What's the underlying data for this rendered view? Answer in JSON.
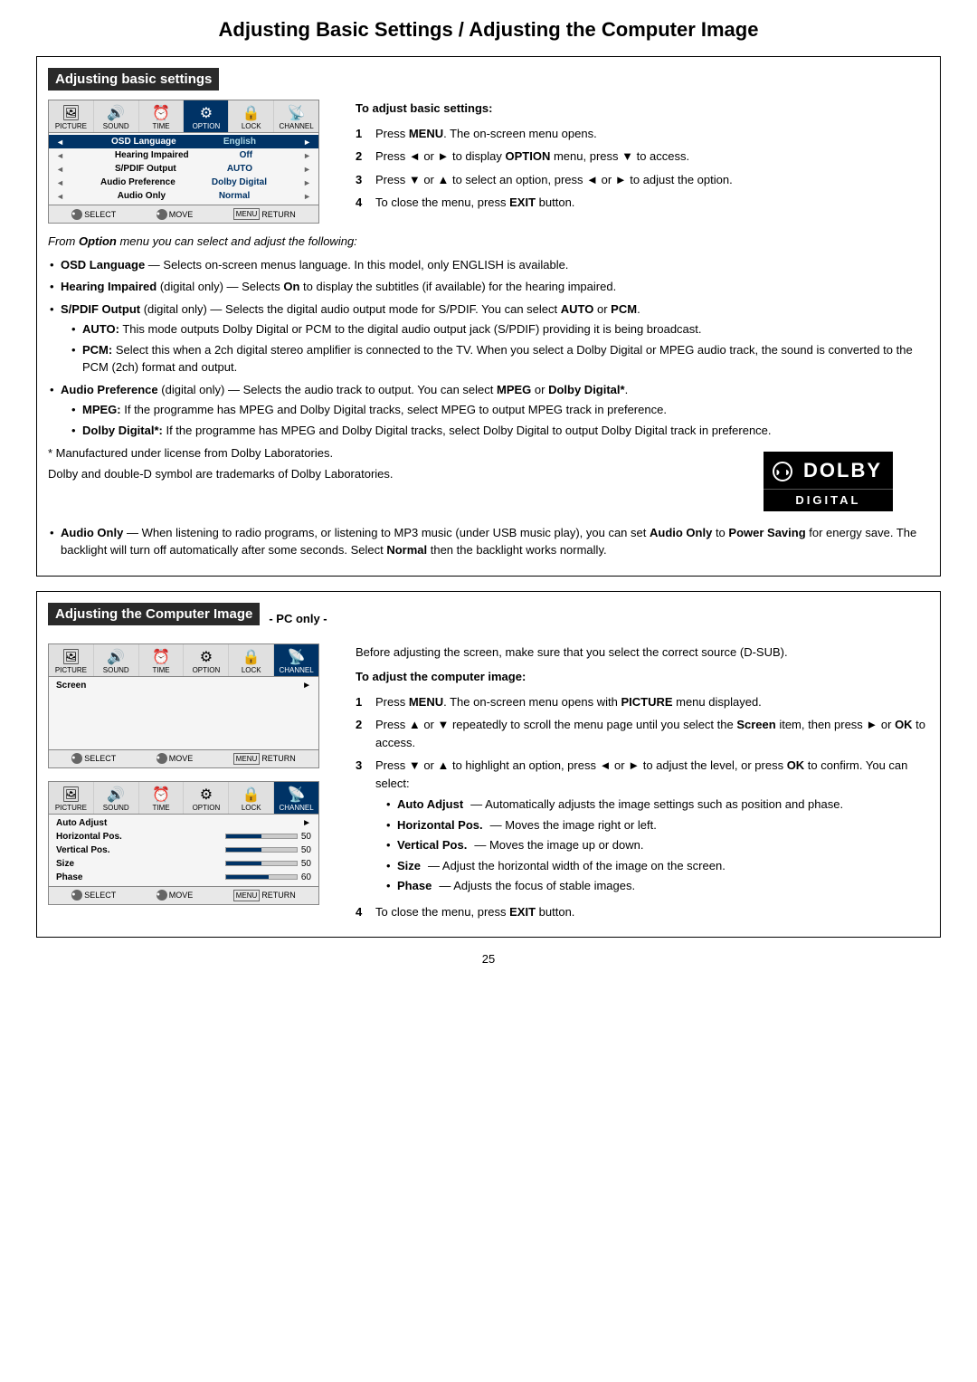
{
  "page": {
    "main_title": "Adjusting Basic Settings / Adjusting the Computer Image",
    "page_number": "25"
  },
  "adjusting_basic": {
    "section_header": "Adjusting basic settings",
    "tv_menu": {
      "icons": [
        {
          "symbol": "🖼",
          "label": "PICTURE"
        },
        {
          "symbol": "🔊",
          "label": "SOUND"
        },
        {
          "symbol": "⏰",
          "label": "TIME"
        },
        {
          "symbol": "⚙",
          "label": "OPTION"
        },
        {
          "symbol": "🔒",
          "label": "LOCK"
        },
        {
          "symbol": "📡",
          "label": "CHANNEL"
        }
      ],
      "rows": [
        {
          "label": "OSD Language",
          "value": "English",
          "highlighted": true
        },
        {
          "label": "Hearing Impaired",
          "value": "Off",
          "highlighted": false
        },
        {
          "label": "S/PDIF Output",
          "value": "AUTO",
          "highlighted": false
        },
        {
          "label": "Audio Preference",
          "value": "Dolby Digital",
          "highlighted": false
        },
        {
          "label": "Audio Only",
          "value": "Normal",
          "highlighted": false
        }
      ],
      "footer": [
        {
          "btn": "●",
          "label": "SELECT"
        },
        {
          "btn": "●",
          "label": "MOVE"
        },
        {
          "btn": "MENU",
          "label": "RETURN"
        }
      ]
    },
    "right_heading": "To adjust basic settings:",
    "steps": [
      {
        "num": "1",
        "text_plain": "Press ",
        "text_bold": "MENU",
        "text_after": ". The on-screen menu opens."
      },
      {
        "num": "2",
        "text_plain": "Press ◄ or ► to display ",
        "text_bold": "OPTION",
        "text_after": " menu, press ▼ to access."
      },
      {
        "num": "3",
        "text_plain": "Press ▼ or ▲ to select an option, press ◄ or ► to adjust the option."
      },
      {
        "num": "4",
        "text_plain": "To close the menu, press ",
        "text_bold": "EXIT",
        "text_after": " button."
      }
    ],
    "from_option_text": "From Option menu you can select and adjust the following:",
    "bullet_items": [
      {
        "bold_label": "OSD Language",
        "dash": " — ",
        "text": "Selects on-screen menus language. In this model, only ENGLISH is available."
      },
      {
        "bold_label": "Hearing Impaired",
        "extra": " (digital only)",
        "dash": " — ",
        "text": "Selects ",
        "bold_mid": "On",
        "text_after": " to display the subtitles (if available) for the hearing impaired."
      },
      {
        "bold_label": "S/PDIF Output",
        "extra": " (digital only)",
        "dash": " — ",
        "text": "Selects the digital audio output mode for S/PDIF. You can select ",
        "bold_mid": "AUTO",
        "text_mid2": " or ",
        "bold_end": "PCM",
        "text_after": ".",
        "sub_items": [
          {
            "bold_label": "AUTO:",
            "text": " This mode outputs Dolby Digital or PCM to the digital audio output jack (S/PDIF) providing it is being broadcast."
          },
          {
            "bold_label": "PCM:",
            "text": " Select this when a 2ch digital stereo amplifier is connected to the TV. When you select a Dolby Digital or MPEG audio track, the sound is converted to the PCM (2ch) format and output."
          }
        ]
      },
      {
        "bold_label": "Audio Preference",
        "extra": " (digital only)",
        "dash": " — ",
        "text": "Selects the audio track to output. You can select ",
        "bold_mid": "MPEG",
        "text_mid2": " or ",
        "bold_end": "Dolby Digital*",
        "text_after": ".",
        "sub_items": [
          {
            "bold_label": "MPEG:",
            "text": " If the programme has MPEG and Dolby Digital tracks, select MPEG to output MPEG track in preference."
          },
          {
            "bold_label": "Dolby Digital*:",
            "text": " If the programme has MPEG and Dolby Digital tracks, select Dolby Digital to output Dolby Digital track in preference."
          }
        ]
      }
    ],
    "trademark_note1": "* Manufactured under license from Dolby Laboratories.",
    "trademark_note2": "Dolby and double-D symbol are trademarks of Dolby Laboratories.",
    "dolby_logo_text": "DOLBY",
    "dolby_digital_text": "DIGITAL",
    "audio_only_bullet": {
      "bold_label": "Audio Only",
      "dash": " — ",
      "text": "When listening to radio programs, or listening to MP3 music (under USB music play), you can set ",
      "bold_mid": "Audio Only",
      "text_mid2": " to ",
      "bold_mid2": "Power Saving",
      "text_after2": " for energy save. The backlight will turn off automatically after some seconds. Select ",
      "bold_end": "Normal",
      "text_end": " then the backlight works normally."
    }
  },
  "adjusting_computer": {
    "section_header": "Adjusting the Computer Image",
    "pc_only_label": "- PC only -",
    "tv_menu1": {
      "icons": [
        {
          "symbol": "🖼",
          "label": "PICTURE"
        },
        {
          "symbol": "🔊",
          "label": "SOUND"
        },
        {
          "symbol": "⏰",
          "label": "TIME"
        },
        {
          "symbol": "⚙",
          "label": "OPTION"
        },
        {
          "symbol": "🔒",
          "label": "LOCK"
        },
        {
          "symbol": "📡",
          "label": "CHANNEL"
        }
      ],
      "rows": [
        {
          "label": "Screen",
          "value": "",
          "arrow": true,
          "highlighted": false
        }
      ]
    },
    "tv_menu2": {
      "icons": [
        {
          "symbol": "🖼",
          "label": "PICTURE"
        },
        {
          "symbol": "🔊",
          "label": "SOUND"
        },
        {
          "symbol": "⏰",
          "label": "TIME"
        },
        {
          "symbol": "⚙",
          "label": "OPTION"
        },
        {
          "symbol": "🔒",
          "label": "LOCK"
        },
        {
          "symbol": "📡",
          "label": "CHANNEL"
        }
      ],
      "rows": [
        {
          "label": "Auto Adjust",
          "value": "",
          "arrow": true,
          "highlighted": false,
          "bar": false
        },
        {
          "label": "Horizontal Pos.",
          "value": "50",
          "highlighted": false,
          "bar": true,
          "bar_pct": 50
        },
        {
          "label": "Vertical Pos.",
          "value": "50",
          "highlighted": false,
          "bar": true,
          "bar_pct": 50
        },
        {
          "label": "Size",
          "value": "50",
          "highlighted": false,
          "bar": true,
          "bar_pct": 50
        },
        {
          "label": "Phase",
          "value": "60",
          "highlighted": false,
          "bar": true,
          "bar_pct": 60
        }
      ]
    },
    "intro_text": "Before adjusting the screen, make sure that you select the correct source (D-SUB).",
    "right_heading": "To adjust the computer image:",
    "steps": [
      {
        "num": "1",
        "text": "Press MENU. The on-screen menu opens with PICTURE menu displayed."
      },
      {
        "num": "2",
        "text": "Press ▲ or ▼ repeatedly to scroll the menu page until you select the Screen item, then press ► or OK to access."
      },
      {
        "num": "3",
        "text": "Press ▼ or ▲ to highlight an option, press ◄ or ► to adjust the level, or press OK to confirm. You can select:"
      },
      {
        "num": "4",
        "text": "To close the menu, press EXIT button."
      }
    ],
    "sub_bullets": [
      {
        "bold_label": "Auto Adjust",
        "dash": " — ",
        "text": "Automatically adjusts the image settings such as position and phase."
      },
      {
        "bold_label": "Horizontal Pos.",
        "dash": " — ",
        "text": "Moves the image right or left."
      },
      {
        "bold_label": "Vertical Pos.",
        "dash": " — ",
        "text": "Moves the image up or down."
      },
      {
        "bold_label": "Size",
        "dash": " — ",
        "text": "Adjust the horizontal width of the image on the screen."
      },
      {
        "bold_label": "Phase",
        "dash": " — ",
        "text": "Adjusts the focus of stable images."
      }
    ]
  }
}
